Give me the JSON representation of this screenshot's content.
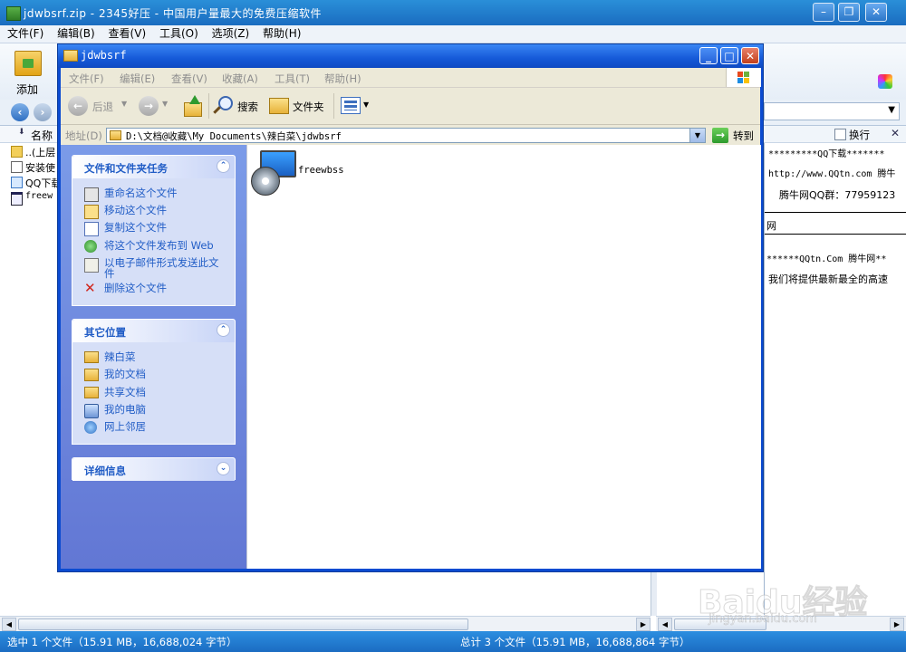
{
  "bg_app": {
    "title": "jdwbsrf.zip - 2345好压 - 中国用户量最大的免费压缩软件",
    "menu": [
      "文件(F)",
      "编辑(B)",
      "查看(V)",
      "工具(O)",
      "选项(Z)",
      "帮助(H)"
    ],
    "toolbar": {
      "add_label": "添加"
    },
    "list_header": "名称",
    "list_items": [
      "..(上层",
      "安装使",
      "QQ下载",
      "freew"
    ],
    "right_pane": {
      "wrap_label": "换行",
      "lines": [
        "*********QQ下载*******",
        "http://www.QQtn.com 腾牛",
        "腾牛网QQ群：77959123",
        "网",
        "******QQtn.Com 腾牛网**",
        "我们将提供最新最全的高速"
      ]
    },
    "status_left": "选中 1 个文件（15.91 MB，16,688,024 字节）",
    "status_right": "总计 3 个文件（15.91 MB，16,688,864 字节）"
  },
  "explorer": {
    "title": "jdwbsrf",
    "menu": [
      "文件(F)",
      "编辑(E)",
      "查看(V)",
      "收藏(A)",
      "工具(T)",
      "帮助(H)"
    ],
    "toolbar": {
      "back": "后退",
      "search": "搜索",
      "folders": "文件夹"
    },
    "address": {
      "label": "地址(D)",
      "path": "D:\\文档@收藏\\My Documents\\辣白菜\\jdwbsrf",
      "go": "转到"
    },
    "task_group": {
      "title": "文件和文件夹任务",
      "items": [
        "重命名这个文件",
        "移动这个文件",
        "复制这个文件",
        "将这个文件发布到 Web",
        "以电子邮件形式发送此文件",
        "删除这个文件"
      ]
    },
    "places_group": {
      "title": "其它位置",
      "items": [
        "辣白菜",
        "我的文档",
        "共享文档",
        "我的电脑",
        "网上邻居"
      ]
    },
    "details_group": {
      "title": "详细信息"
    },
    "files": [
      {
        "name": "freewbss"
      }
    ]
  },
  "watermark": {
    "brand": "Baidu经验",
    "url": "jingyan.baidu.com"
  }
}
